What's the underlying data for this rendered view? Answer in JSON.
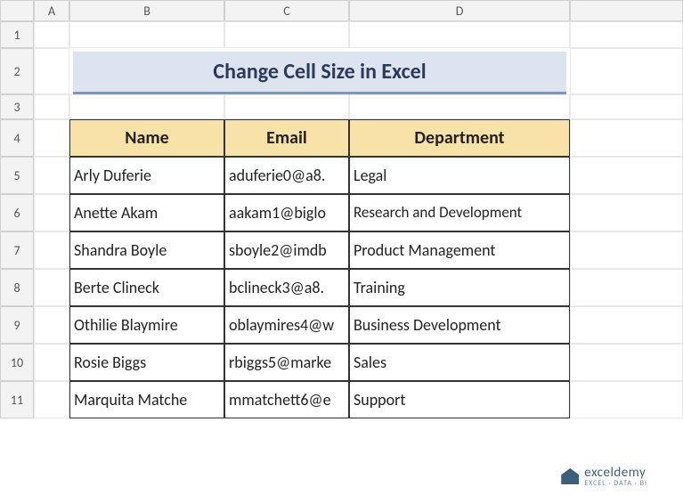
{
  "columns": [
    "A",
    "B",
    "C",
    "D"
  ],
  "rows": [
    "1",
    "2",
    "3",
    "4",
    "5",
    "6",
    "7",
    "8",
    "9",
    "10",
    "11"
  ],
  "title": "Change Cell Size in Excel",
  "headers": {
    "name": "Name",
    "email": "Email",
    "dept": "Department"
  },
  "data": [
    {
      "name": "Arly Duferie",
      "email": "aduferie0@a8.",
      "dept": "Legal"
    },
    {
      "name": "Anette Akam",
      "email": "aakam1@biglo",
      "dept": "Research and Development"
    },
    {
      "name": "Shandra Boyle",
      "email": "sboyle2@imdb",
      "dept": "Product Management"
    },
    {
      "name": "Berte Clineck",
      "email": "bclineck3@a8.",
      "dept": "Training"
    },
    {
      "name": "Othilie Blaymire",
      "email": "oblaymires4@w",
      "dept": "Business Development"
    },
    {
      "name": "Rosie Biggs",
      "email": "rbiggs5@marke",
      "dept": "Sales"
    },
    {
      "name": "Marquita Matche",
      "email": "mmatchett6@e",
      "dept": "Support"
    }
  ],
  "watermark": {
    "brand": "exceldemy",
    "tagline": "EXCEL · DATA · BI"
  }
}
